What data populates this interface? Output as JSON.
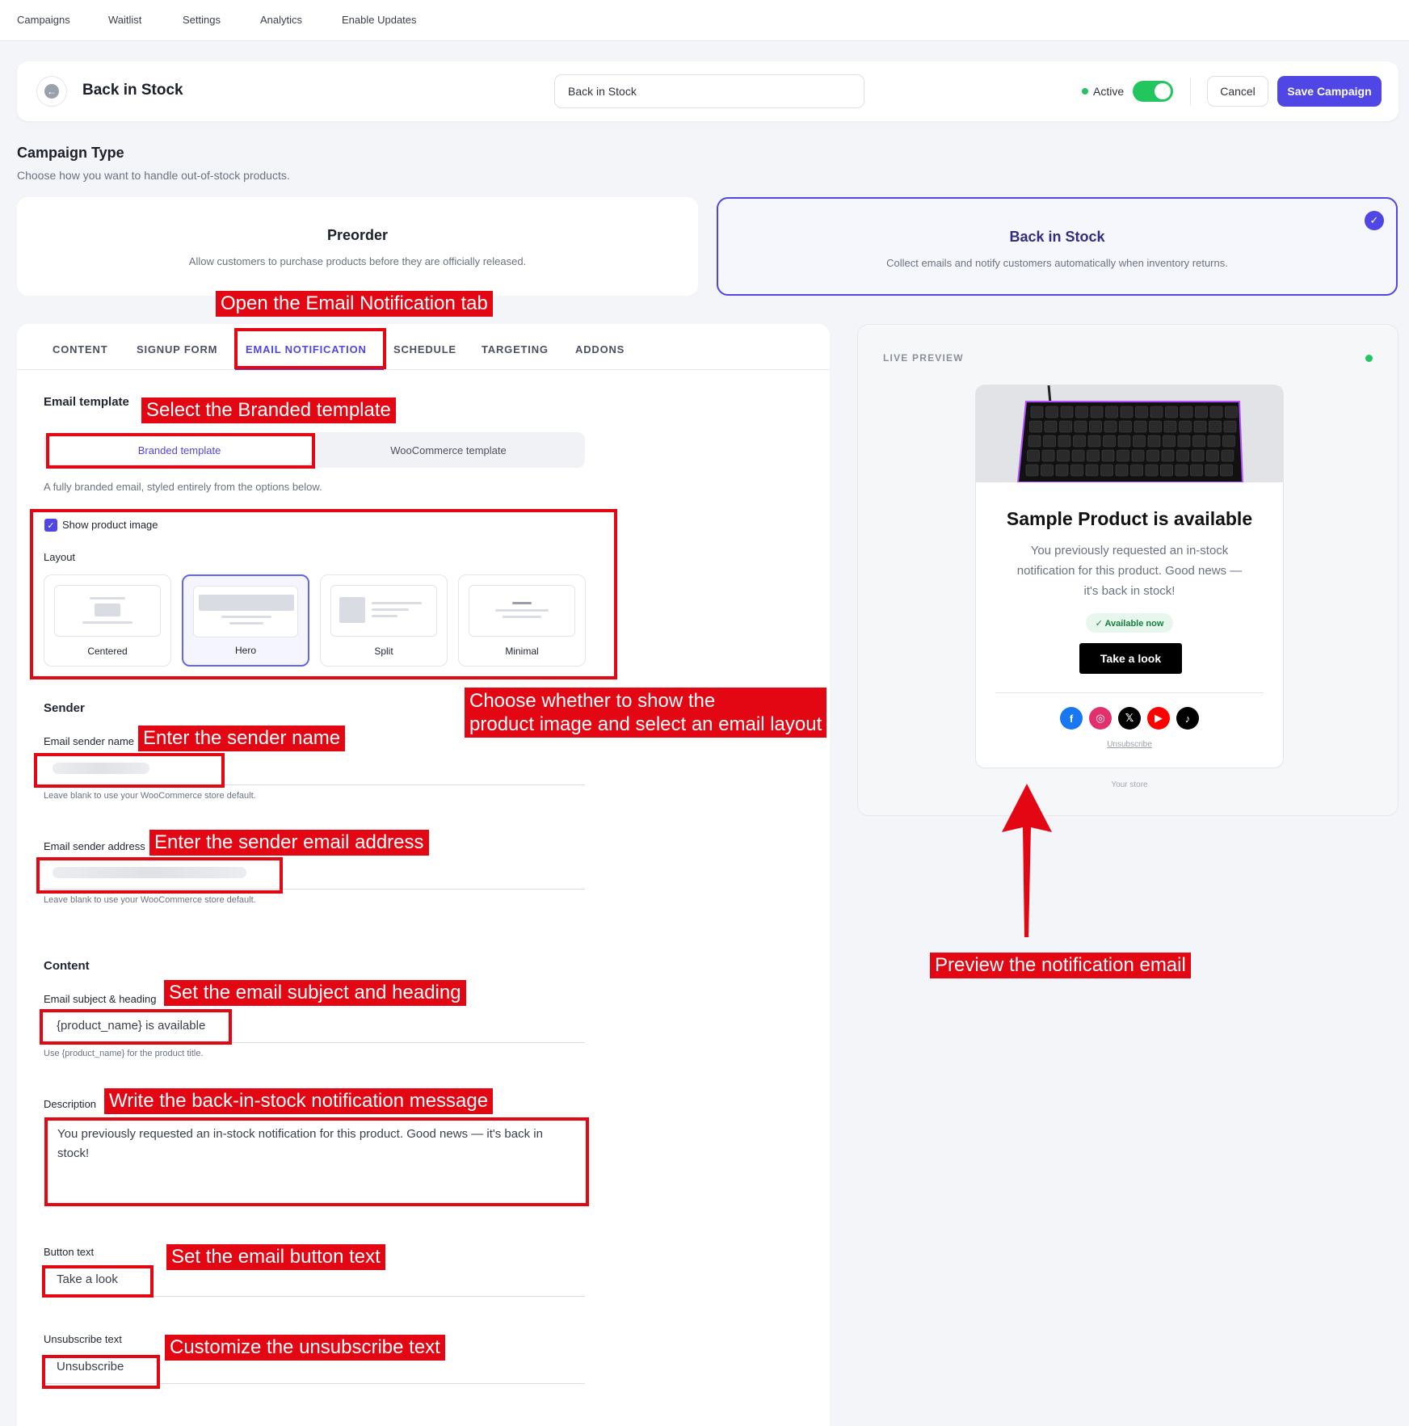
{
  "topnav": {
    "items": [
      "Campaigns",
      "Waitlist",
      "Settings",
      "Analytics",
      "Enable Updates"
    ]
  },
  "header": {
    "back_icon": "arrow-left-icon",
    "title": "Back in Stock",
    "name_value": "Back in Stock",
    "status_label": "Active",
    "status_color": "#22c55e",
    "cancel_label": "Cancel",
    "save_label": "Save Campaign",
    "accent_color": "#4f46e5"
  },
  "campaign_type": {
    "title": "Campaign Type",
    "description": "Choose how you want to handle out-of-stock products.",
    "options": [
      {
        "title": "Preorder",
        "desc": "Allow customers to purchase products before they are officially released."
      },
      {
        "title": "Back in Stock",
        "desc": "Collect emails and notify customers automatically when inventory returns.",
        "selected": true
      }
    ],
    "check_icon": "check-icon"
  },
  "tabs": [
    "CONTENT",
    "SIGNUP FORM",
    "EMAIL NOTIFICATION",
    "SCHEDULE",
    "TARGETING",
    "ADDONS"
  ],
  "active_tab": "EMAIL NOTIFICATION",
  "email": {
    "template_label": "Email template",
    "template_options": [
      "Branded template",
      "WooCommerce template"
    ],
    "selected_template": "Branded template",
    "template_hint": "A fully branded email, styled entirely from the options below.",
    "show_image_label": "Show product image",
    "show_image_checked": true,
    "layout_label": "Layout",
    "layouts": [
      "Centered",
      "Hero",
      "Split",
      "Minimal"
    ],
    "selected_layout": "Hero",
    "sender_heading": "Sender",
    "sender_name_label": "Email sender name",
    "sender_name_hint": "Leave blank to use your WooCommerce store default.",
    "sender_address_label": "Email sender address",
    "sender_address_hint": "Leave blank to use your WooCommerce store default.",
    "content_heading": "Content",
    "subject_label": "Email subject & heading",
    "subject_value": "{product_name} is available",
    "subject_hint": "Use {product_name} for the product title.",
    "description_label": "Description",
    "description_value": "You previously requested an in-stock notification for this product. Good news — it's back in stock!",
    "button_label": "Button text",
    "button_value": "Take a look",
    "unsub_label": "Unsubscribe text",
    "unsub_value": "Unsubscribe"
  },
  "preview": {
    "label": "LIVE PREVIEW",
    "title": "Sample Product is available",
    "body": "You previously requested an in-stock notification for this product. Good news — it's back in stock!",
    "pill": "✓ Available now",
    "button": "Take a look",
    "socials": [
      {
        "icon": "facebook-icon",
        "glyph": "f",
        "color": "#1877f2"
      },
      {
        "icon": "instagram-icon",
        "glyph": "◎",
        "color": "#e1306c"
      },
      {
        "icon": "x-icon",
        "glyph": "𝕏",
        "color": "#000000"
      },
      {
        "icon": "youtube-icon",
        "glyph": "▶",
        "color": "#ff0000"
      },
      {
        "icon": "tiktok-icon",
        "glyph": "♪",
        "color": "#000000"
      }
    ],
    "unsubscribe": "Unsubscribe",
    "footer": "Your store"
  },
  "annotations": [
    "Open the Email Notification tab",
    "Select the Branded template",
    "Choose whether to show the",
    "product image and select an email layout",
    "Enter the sender name",
    "Enter the sender email address",
    "Set the email subject and heading",
    "Write the back-in-stock notification message",
    "Set the email button text",
    "Customize the unsubscribe text",
    "Preview the notification email"
  ]
}
